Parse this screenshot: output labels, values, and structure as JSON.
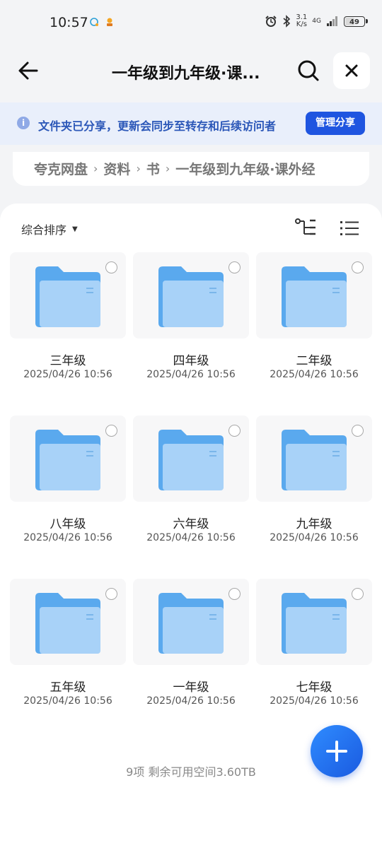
{
  "status_bar": {
    "time": "10:57",
    "net_speed_value": "3.1",
    "net_speed_unit": "K/s",
    "network": "4G",
    "battery": "49"
  },
  "header": {
    "title": "一年级到九年级·课..."
  },
  "share_banner": {
    "text": "文件夹已分享，更新会同步至转存和后续访问者",
    "button_label": "管理分享"
  },
  "breadcrumb": {
    "items": [
      "夸克网盘",
      "资料",
      "书",
      "一年级到九年级·课外经"
    ]
  },
  "toolbar": {
    "sort_label": "综合排序"
  },
  "folders": [
    {
      "name": "三年级",
      "date": "2025/04/26 10:56"
    },
    {
      "name": "四年级",
      "date": "2025/04/26 10:56"
    },
    {
      "name": "二年级",
      "date": "2025/04/26 10:56"
    },
    {
      "name": "八年级",
      "date": "2025/04/26 10:56"
    },
    {
      "name": "六年级",
      "date": "2025/04/26 10:56"
    },
    {
      "name": "九年级",
      "date": "2025/04/26 10:56"
    },
    {
      "name": "五年级",
      "date": "2025/04/26 10:56"
    },
    {
      "name": "一年级",
      "date": "2025/04/26 10:56"
    },
    {
      "name": "七年级",
      "date": "2025/04/26 10:56"
    }
  ],
  "footer": {
    "summary": "9项 剩余可用空间3.60TB"
  },
  "colors": {
    "accent": "#1f55e0",
    "banner_bg": "#e9effb",
    "folder": "#5aa9ee"
  },
  "icons": {
    "back": "arrow-left-icon",
    "search": "search-icon",
    "close": "close-icon",
    "info": "info-icon",
    "tree_view": "tree-view-icon",
    "list_view": "list-view-icon",
    "folder": "folder-icon",
    "add": "plus-icon"
  }
}
